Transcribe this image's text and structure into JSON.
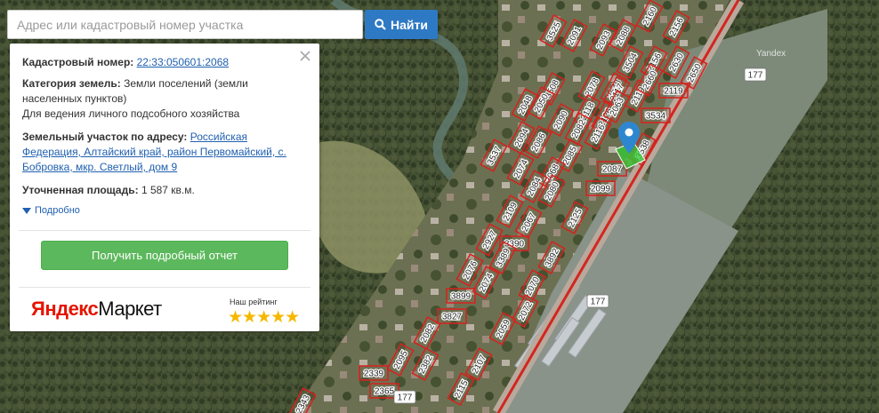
{
  "search": {
    "placeholder": "Адрес или кадастровый номер участка",
    "button_label": "Найти"
  },
  "info": {
    "cadastral_label": "Кадастровый номер:",
    "cadastral_number": "22:33:050601:2068",
    "category_label": "Категория земель:",
    "category_value": "Земли поселений (земли населенных пунктов)",
    "usage": "Для ведения личного подсобного хозяйства",
    "address_label": "Земельный участок по адресу:",
    "address_value": "Российская Федерация, Алтайский край, район Первомайский, с. Бобровка, мкр. Светлый, дом 9",
    "area_label": "Уточненная площадь:",
    "area_value": "1 587 кв.м.",
    "more_label": "Подробно",
    "report_button": "Получить подробный отчет"
  },
  "ad": {
    "brand_part1": "Яндекс",
    "brand_part2": "Маркет",
    "rating_label": "Наш рейтинг",
    "stars": "★★★★★"
  },
  "map": {
    "attribution": "Yandex",
    "road_labels": [
      "177",
      "177",
      "177"
    ],
    "parcel_labels": [
      "3525",
      "2091",
      "2093",
      "2088",
      "2160",
      "2156",
      "3504",
      "2156",
      "2630",
      "2650",
      "2648",
      "3508",
      "2078",
      "2117",
      "2119",
      "2119",
      "2660",
      "2050",
      "2048",
      "2118",
      "2126",
      "2063",
      "3534",
      "2090",
      "2082",
      "2116",
      "2094",
      "2086",
      "3537",
      "2085",
      "2068",
      "2087",
      "2074",
      "2099",
      "2080",
      "2084",
      "2109",
      "2067",
      "2125",
      "2927",
      "3390",
      "3389",
      "3892",
      "2076",
      "2074",
      "3899",
      "2070",
      "3827",
      "2072",
      "2059",
      "2082",
      "2339",
      "2095",
      "2382",
      "2107",
      "2115",
      "2365",
      "2343",
      "3538"
    ],
    "colors": {
      "parcel_outline": "#d9201c",
      "selected_parcel": "#33cc33",
      "pin": "#2f86d0"
    },
    "icons": [
      "location-pin-icon",
      "search-icon",
      "close-icon",
      "triangle-down-icon"
    ]
  }
}
